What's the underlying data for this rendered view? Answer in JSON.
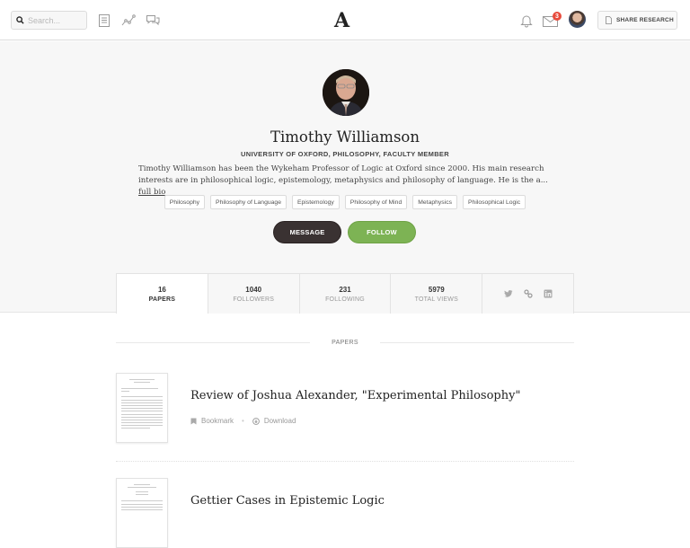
{
  "topnav": {
    "search_placeholder": "Search...",
    "logo": "A",
    "notifications_badge": "3",
    "share_button": "SHARE RESEARCH",
    "icons": [
      "search-icon",
      "papers-icon",
      "analytics-icon",
      "messages-icon",
      "bell-icon",
      "mail-icon",
      "user-avatar",
      "document-icon"
    ]
  },
  "profile": {
    "name": "Timothy Williamson",
    "affiliation": "UNIVERSITY OF OXFORD, PHILOSOPHY, FACULTY MEMBER",
    "bio": "Timothy Williamson has been the Wykeham Professor of Logic at Oxford since 2000. His main research interests are in philosophical logic, epistemology, metaphysics and philosophy of language. He is the a...",
    "full_bio_link": "full bio",
    "tags": [
      "Philosophy",
      "Philosophy of Language",
      "Epistemology",
      "Philosophy of Mind",
      "Metaphysics",
      "Philosophical Logic"
    ],
    "message_button": "MESSAGE",
    "follow_button": "FOLLOW",
    "colors": {
      "follow": "#7db354",
      "message": "#3a3232"
    }
  },
  "stats": [
    {
      "value": "16",
      "label": "PAPERS",
      "active": true
    },
    {
      "value": "1040",
      "label": "FOLLOWERS"
    },
    {
      "value": "231",
      "label": "FOLLOWING"
    },
    {
      "value": "5979",
      "label": "TOTAL VIEWS"
    }
  ],
  "social_icons": [
    "twitter-icon",
    "link-icon",
    "linkedin-icon"
  ],
  "papers": {
    "section_label": "PAPERS",
    "items": [
      {
        "title": "Review of Joshua Alexander, \"Experimental Philosophy\"",
        "bookmark": "Bookmark",
        "download": "Download"
      },
      {
        "title": "Gettier Cases in Epistemic Logic"
      }
    ]
  }
}
